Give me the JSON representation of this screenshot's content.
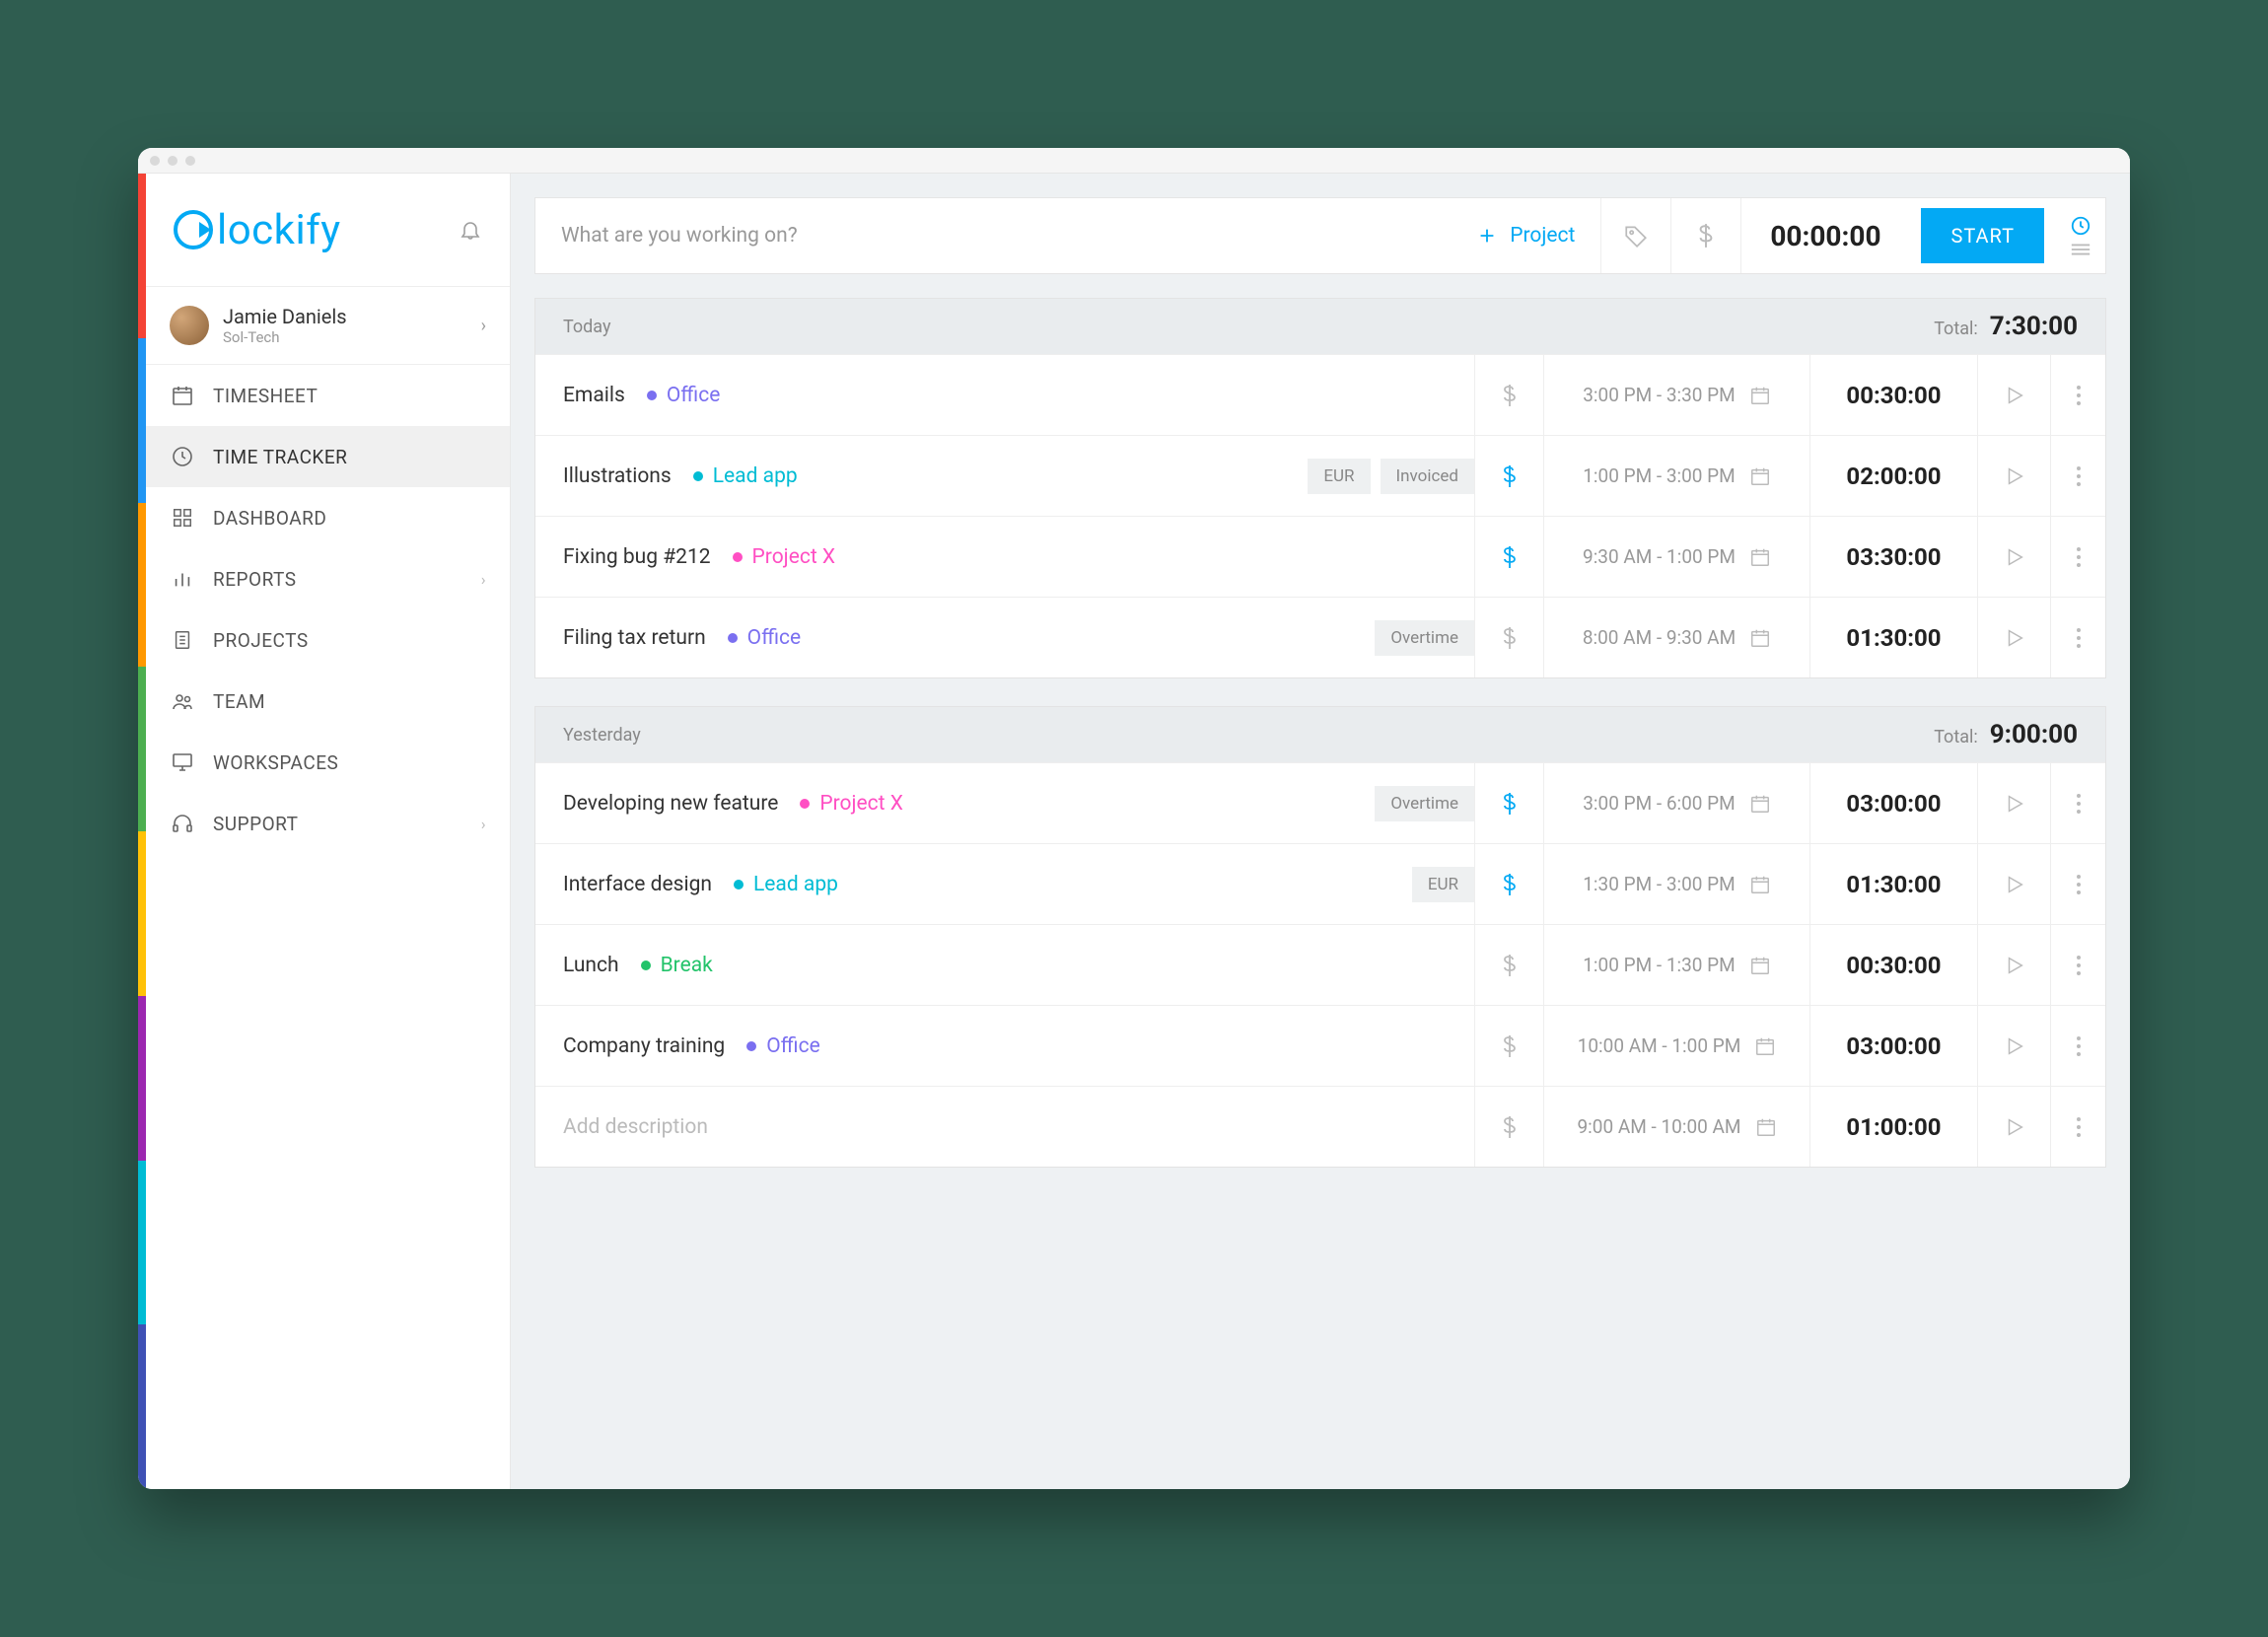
{
  "brand": "lockify",
  "user": {
    "name": "Jamie Daniels",
    "org": "Sol-Tech"
  },
  "nav": {
    "timesheet": "TIMESHEET",
    "tracker": "TIME TRACKER",
    "dashboard": "DASHBOARD",
    "reports": "REPORTS",
    "projects": "PROJECTS",
    "team": "TEAM",
    "workspaces": "WORKSPACES",
    "support": "SUPPORT"
  },
  "colorbar": [
    "#f44336",
    "#2196f3",
    "#ff9800",
    "#4caf50",
    "#ffc107",
    "#9c27b0",
    "#00bcd4",
    "#3f51b5"
  ],
  "toolbar": {
    "placeholder": "What are you working on?",
    "project_label": "Project",
    "timer": "00:00:00",
    "start": "START"
  },
  "projects": {
    "office": {
      "name": "Office",
      "color": "#7a6ff0"
    },
    "leadapp": {
      "name": "Lead app",
      "color": "#00bcd4"
    },
    "projectx": {
      "name": "Project X",
      "color": "#ff4fc3"
    },
    "break": {
      "name": "Break",
      "color": "#23c36a"
    }
  },
  "groups": [
    {
      "label": "Today",
      "total_label": "Total:",
      "total": "7:30:00",
      "entries": [
        {
          "desc": "Emails",
          "project": "office",
          "tags": [],
          "billable": false,
          "range": "3:00 PM - 3:30 PM",
          "duration": "00:30:00"
        },
        {
          "desc": "Illustrations",
          "project": "leadapp",
          "tags": [
            "EUR",
            "Invoiced"
          ],
          "billable": true,
          "range": "1:00 PM - 3:00 PM",
          "duration": "02:00:00"
        },
        {
          "desc": "Fixing bug #212",
          "project": "projectx",
          "tags": [],
          "billable": true,
          "range": "9:30 AM - 1:00 PM",
          "duration": "03:30:00"
        },
        {
          "desc": "Filing tax return",
          "project": "office",
          "tags": [
            "Overtime"
          ],
          "billable": false,
          "range": "8:00 AM - 9:30 AM",
          "duration": "01:30:00"
        }
      ]
    },
    {
      "label": "Yesterday",
      "total_label": "Total:",
      "total": "9:00:00",
      "entries": [
        {
          "desc": "Developing new feature",
          "project": "projectx",
          "tags": [
            "Overtime"
          ],
          "billable": true,
          "range": "3:00 PM - 6:00 PM",
          "duration": "03:00:00"
        },
        {
          "desc": "Interface design",
          "project": "leadapp",
          "tags": [
            "EUR"
          ],
          "billable": true,
          "range": "1:30 PM - 3:00 PM",
          "duration": "01:30:00"
        },
        {
          "desc": "Lunch",
          "project": "break",
          "tags": [],
          "billable": false,
          "range": "1:00 PM - 1:30 PM",
          "duration": "00:30:00"
        },
        {
          "desc": "Company training",
          "project": "office",
          "tags": [],
          "billable": false,
          "range": "10:00 AM - 1:00 PM",
          "duration": "03:00:00"
        },
        {
          "desc": "",
          "placeholder": "Add description",
          "project": null,
          "tags": [],
          "billable": false,
          "range": "9:00 AM - 10:00 AM",
          "duration": "01:00:00"
        }
      ]
    }
  ]
}
